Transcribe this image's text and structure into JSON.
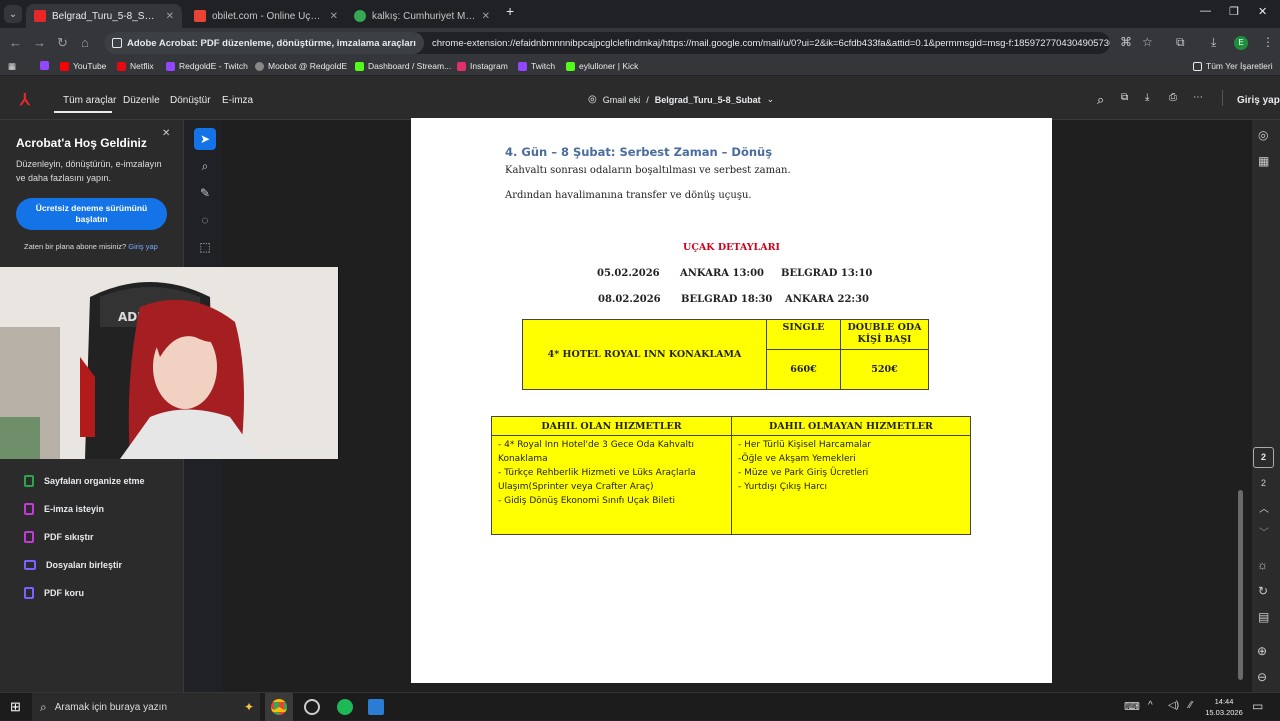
{
  "tabs": [
    {
      "title": "Belgrad_Turu_5-8_Subat.pdf",
      "icon": "pdf-icon",
      "color": "#e8272b",
      "active": true
    },
    {
      "title": "obilet.com - Online Uçak Bileti",
      "icon": "gmail-icon",
      "color": "#ea4335",
      "active": false
    },
    {
      "title": "kalkış: Cumhuriyet Meydanı var",
      "icon": "maps-pin-icon",
      "color": "#34a853",
      "active": false
    }
  ],
  "omnibox": {
    "chip": "Adobe Acrobat: PDF düzenleme, dönüştürme, imzalama araçları",
    "url": "chrome-extension://efaidnbmnnnibpcajpcglclefindmkaj/https://mail.google.com/mail/u/0?ui=2&ik=6cfdb433fa&attid=0.1&permmsgid=msg-f:1859727704304905736&th=19cf14...",
    "profile": "E"
  },
  "bookmarks": [
    {
      "label": "YouTube",
      "color": "#ff0000"
    },
    {
      "label": "Netflix",
      "color": "#e50914"
    },
    {
      "label": "RedgoldE - Twitch",
      "color": "#9146ff"
    },
    {
      "label": "Moobot @ RedgoldE",
      "color": "#444"
    },
    {
      "label": "Dashboard / Stream...",
      "color": "#53fc18"
    },
    {
      "label": "Instagram",
      "color": "#e1306c"
    },
    {
      "label": "Twitch",
      "color": "#9146ff"
    },
    {
      "label": "eylulloner | Kick",
      "color": "#53fc18"
    }
  ],
  "bookmarks_all": "Tüm Yer İşaretleri",
  "acrobat": {
    "menu": [
      "Tüm araçlar",
      "Düzenle",
      "Dönüştür",
      "E-imza"
    ],
    "breadcrumb_parent": "Gmail eki",
    "sep": "/",
    "filename": "Belgrad_Turu_5-8_Subat",
    "signin": "Giriş yap"
  },
  "welcome": {
    "title": "Acrobat'a Hoş Geldiniz",
    "text": "Düzenleyin, dönüştürün, e-imzalayın ve daha fazlasını yapın.",
    "cta": "Ücretsiz deneme sürümünü başlatın",
    "already": "Zaten bir plana abone misiniz?",
    "signin": "Giriş yap"
  },
  "left_tools": [
    {
      "label": "Sayfaları organize etme",
      "color": "#2da44e"
    },
    {
      "label": "E-imza isteyin",
      "color": "#c23ad9"
    },
    {
      "label": "PDF sıkıştır",
      "color": "#c23ad9"
    },
    {
      "label": "Dosyaları birleştir",
      "color": "#7b61ff"
    },
    {
      "label": "PDF koru",
      "color": "#7b61ff"
    }
  ],
  "doc": {
    "day_heading": "4. Gün – 8 Şubat: Serbest Zaman – Dönüş",
    "p1": "Kahvaltı sonrası odaların boşaltılması ve serbest zaman.",
    "p2": "Ardından havalimanına transfer ve dönüş uçuşu.",
    "flight_title": "UÇAK DETAYLARI",
    "flights": [
      {
        "date": "05.02.2026",
        "from": "ANKARA 13:00",
        "to": "BELGRAD 13:10"
      },
      {
        "date": "08.02.2026",
        "from": "BELGRAD 18:30",
        "to": "ANKARA 22:30"
      }
    ],
    "hotel": {
      "name": "4* HOTEL ROYAL INN KONAKLAMA",
      "single_label": "SINGLE",
      "double_label": "DOUBLE ODA KİŞİ BAŞI",
      "single_price": "660€",
      "double_price": "520€"
    },
    "included_title": "DAHIL OLAN HIZMETLER",
    "excluded_title": "DAHIL OLMAYAN HIZMETLER",
    "included": [
      "- 4* Royal Inn Hotel'de 3 Gece Oda Kahvaltı Konaklama",
      "- Türkçe Rehberlik Hizmeti ve Lüks Araçlarla Ulaşım(Sprinter veya Crafter Araç)",
      "- Gidiş Dönüş Ekonomi Sınıfı Uçak Bileti"
    ],
    "excluded": [
      "- Her Türlü Kişisel Harcamalar",
      "-Öğle ve Akşam Yemekleri",
      "- Müze ve Park Giriş Ücretleri",
      "- Yurtdışı Çıkış Harcı"
    ]
  },
  "page_indicator": {
    "current": "2",
    "total": "2"
  },
  "taskbar": {
    "search": "Aramak için buraya yazın",
    "time": "14:44",
    "date": "15.03.2026"
  }
}
